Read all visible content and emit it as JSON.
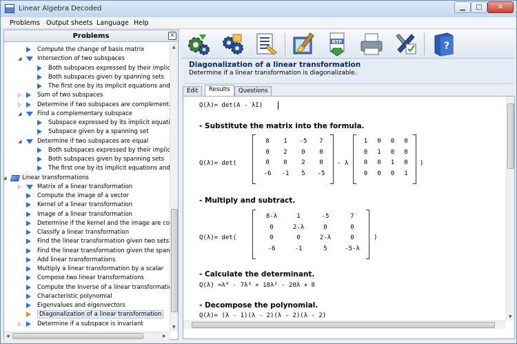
{
  "window": {
    "title": "Linear Algebra Decoded"
  },
  "menu": [
    "Problems",
    "Output sheets",
    "Language",
    "Help"
  ],
  "problems_panel": {
    "title": "Problems",
    "close": "✕",
    "tree": [
      {
        "level": 2,
        "icon": "right",
        "toggle": "",
        "label": "Compute the change of basis matrix"
      },
      {
        "level": 2,
        "icon": "down",
        "toggle": "◢",
        "label": "Intersection of two subspaces"
      },
      {
        "level": 3,
        "icon": "right",
        "toggle": "",
        "label": "Both subspaces expressed by their implicit e"
      },
      {
        "level": 3,
        "icon": "right",
        "toggle": "",
        "label": "Both subspaces given by spanning sets"
      },
      {
        "level": 3,
        "icon": "right",
        "toggle": "",
        "label": "The first one by its implicit equations and the"
      },
      {
        "level": 2,
        "icon": "right",
        "toggle": "▷",
        "label": "Sum of two subspaces"
      },
      {
        "level": 2,
        "icon": "right",
        "toggle": "▷",
        "label": "Determine if two subspaces are complementary"
      },
      {
        "level": 2,
        "icon": "down",
        "toggle": "◢",
        "label": "Find a complementary subspace"
      },
      {
        "level": 3,
        "icon": "right",
        "toggle": "",
        "label": "Subspace expressed by its implicit equations"
      },
      {
        "level": 3,
        "icon": "right",
        "toggle": "",
        "label": "Subspace given by a spanning set"
      },
      {
        "level": 2,
        "icon": "down",
        "toggle": "◢",
        "label": "Determine if two subspaces are equal"
      },
      {
        "level": 3,
        "icon": "right",
        "toggle": "",
        "label": "Both subspaces expressed by their implicit e"
      },
      {
        "level": 3,
        "icon": "right",
        "toggle": "",
        "label": "Both subspaces given by spanning sets"
      },
      {
        "level": 3,
        "icon": "right",
        "toggle": "",
        "label": "The first one by its implicit equations and the"
      },
      {
        "level": 1,
        "icon": "folder",
        "toggle": "◢",
        "label": "Linear transformations"
      },
      {
        "level": 2,
        "icon": "down",
        "toggle": "▷",
        "label": "Matrix of a linear transformation"
      },
      {
        "level": 2,
        "icon": "right",
        "toggle": "",
        "label": "Compute the image of a vector"
      },
      {
        "level": 2,
        "icon": "right",
        "toggle": "",
        "label": "Kernel of a linear transformation"
      },
      {
        "level": 2,
        "icon": "right",
        "toggle": "",
        "label": "Image of a linear transformation"
      },
      {
        "level": 2,
        "icon": "right",
        "toggle": "",
        "label": "Determine if the kernel and the image are compl"
      },
      {
        "level": 2,
        "icon": "right",
        "toggle": "",
        "label": "Classify a linear transformation"
      },
      {
        "level": 2,
        "icon": "right",
        "toggle": "",
        "label": "Find the linear transformation given two sets of"
      },
      {
        "level": 2,
        "icon": "right",
        "toggle": "",
        "label": "Find the linear transformation given the spannin"
      },
      {
        "level": 2,
        "icon": "right",
        "toggle": "",
        "label": "Add linear transformations"
      },
      {
        "level": 2,
        "icon": "right",
        "toggle": "",
        "label": "Multiply a linear transformation by a scalar"
      },
      {
        "level": 2,
        "icon": "right",
        "toggle": "",
        "label": "Compose two linear transformations"
      },
      {
        "level": 2,
        "icon": "right",
        "toggle": "",
        "label": "Compute the Inverse of a linear transformation"
      },
      {
        "level": 2,
        "icon": "right",
        "toggle": "",
        "label": "Characteristic polynomial"
      },
      {
        "level": 2,
        "icon": "right",
        "toggle": "",
        "label": "Eigenvalues and eigenvectors"
      },
      {
        "level": 2,
        "icon": "right",
        "toggle": "",
        "label": "Diagonalization of a linear transformation",
        "selected": true
      },
      {
        "level": 2,
        "icon": "right",
        "toggle": "▷",
        "label": "Determine if a subspace is invariant"
      }
    ]
  },
  "toolbar": {
    "buttons": [
      "solve-gear-icon",
      "step-by-step-icon",
      "theory-document-icon",
      "clear-brush-icon",
      "export-rtf-icon",
      "print-icon",
      "settings-tools-icon",
      "help-book-icon"
    ],
    "rtf_label": "RTF"
  },
  "problem": {
    "title": "Diagonalization of a linear transformation",
    "subtitle": "Determine if a linear transformation is diagonalizable."
  },
  "tabs": [
    "Edit",
    "Results",
    "Questions"
  ],
  "results": {
    "formula": "Q(λ)= det(A - λI)",
    "heading1": "- Substitute the matrix into the formula.",
    "eq1_prefix": "Q(λ)= det(",
    "matrix_a": [
      [
        "8",
        "1",
        "-5",
        "7"
      ],
      [
        "0",
        "2",
        "0",
        "0"
      ],
      [
        "0",
        "0",
        "2",
        "0"
      ],
      [
        "-6",
        "-1",
        "5",
        "-5"
      ]
    ],
    "minus_lambda": "- λ",
    "identity": [
      [
        "1",
        "0",
        "0",
        "0"
      ],
      [
        "0",
        "1",
        "0",
        "0"
      ],
      [
        "0",
        "0",
        "1",
        "0"
      ],
      [
        "0",
        "0",
        "0",
        "1"
      ]
    ],
    "close_paren": ")",
    "heading2": "- Multiply and subtract.",
    "eq2_prefix": "Q(λ)= det(",
    "matrix_b": [
      [
        "8-λ",
        "1",
        "-5",
        "7"
      ],
      [
        "0",
        "2-λ",
        "0",
        "0"
      ],
      [
        "0",
        "0",
        "2-λ",
        "0"
      ],
      [
        "-6",
        "-1",
        "5",
        "-5-λ"
      ]
    ],
    "heading3": "- Calculate the determinant.",
    "determinant": "Q(λ) =λ⁴ - 7λ³ + 18λ² - 20λ + 8",
    "heading4": "- Decompose the polynomial.",
    "decomposition": "Q(λ)= (λ - 1)(λ - 2)(λ - 2)(λ - 2)"
  }
}
